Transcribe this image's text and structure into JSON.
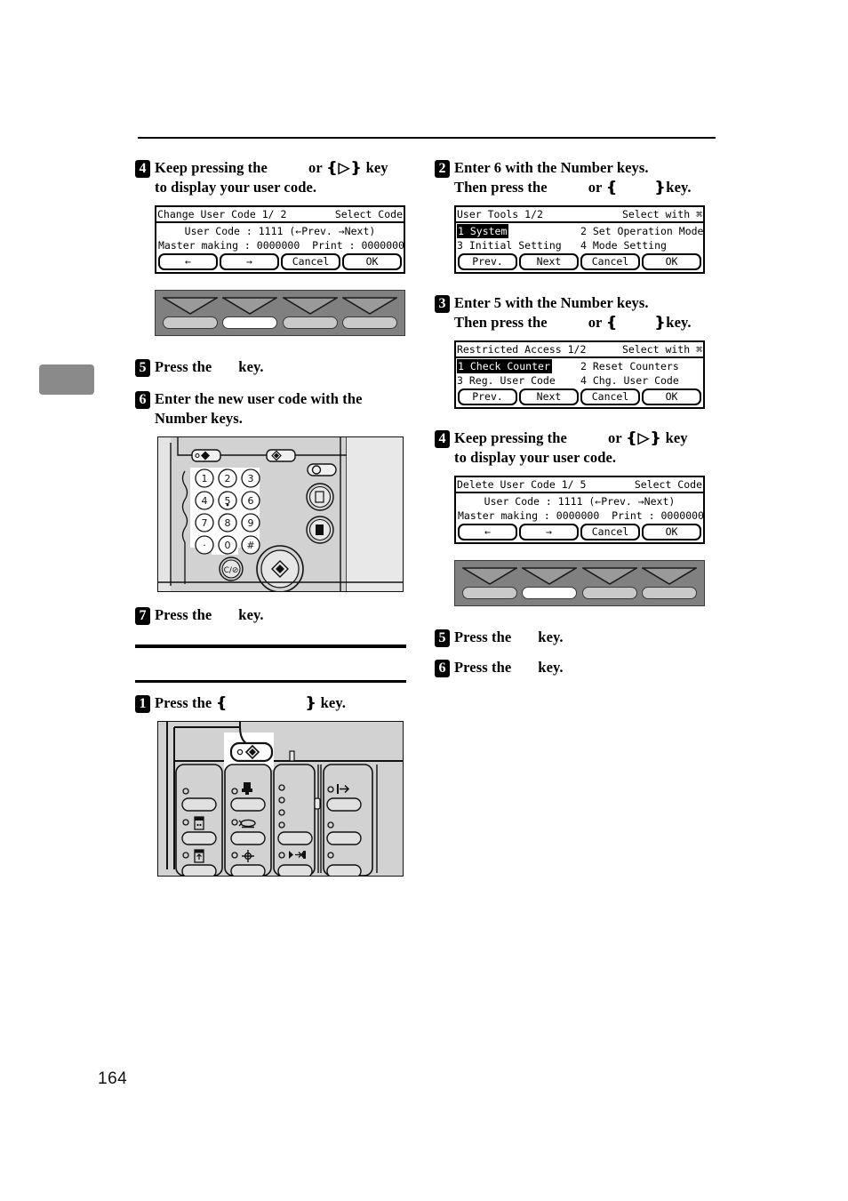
{
  "page": {
    "number": "164"
  },
  "left_column": {
    "steps": [
      {
        "num": "4",
        "line1_a": "Keep pressing the",
        "line1_b": "or",
        "line1_key": "▷",
        "line1_c": "key",
        "line2": "to display your user code."
      },
      {
        "num": "5",
        "line1_a": "Press the",
        "line1_c": "key."
      },
      {
        "num": "6",
        "line1_a": "Enter the new user code with the",
        "line2": "Number keys."
      },
      {
        "num": "7",
        "line1_a": "Press the",
        "line1_c": "key."
      },
      {
        "num": "1",
        "line1_a": "Press the",
        "line1_c": "key."
      }
    ],
    "lcd": {
      "title_left": "Change User Code  1/ 2",
      "title_right": "Select Code",
      "line1": "User Code : 1111 (←Prev. →Next)",
      "line2_left": "Master making : 0000000",
      "line2_right": "Print : 0000000",
      "buttons": [
        "←",
        "→",
        "Cancel",
        "OK"
      ]
    },
    "keystrip": {
      "keys": [
        "key-1",
        "key-2-selected",
        "key-3",
        "key-4"
      ],
      "highlighted_index": 1
    },
    "keypad_illustration": {
      "name": "number-keys-illustration",
      "keys": [
        "1",
        "2",
        "3",
        "4",
        "5",
        "6",
        "7",
        "8",
        "9",
        "·",
        "0",
        "#"
      ],
      "clear_stop_label": "C/⊘"
    },
    "panel_illustration": {
      "name": "operation-panel-illustration"
    }
  },
  "right_column": {
    "steps": [
      {
        "num": "2",
        "line1": "Enter 6 with the Number keys.",
        "line2_a": "Then press the",
        "line2_b": "or",
        "line2_c": "key."
      },
      {
        "num": "3",
        "line1": "Enter 5 with the Number keys.",
        "line2_a": "Then press the",
        "line2_b": "or",
        "line2_c": "key."
      },
      {
        "num": "4",
        "line1_a": "Keep pressing the",
        "line1_b": "or",
        "line1_key": "▷",
        "line1_c": "key",
        "line2": "to display your user code."
      },
      {
        "num": "5",
        "line1_a": "Press the",
        "line1_c": "key."
      },
      {
        "num": "6",
        "line1_a": "Press the",
        "line1_c": "key."
      }
    ],
    "lcd_user_tools": {
      "title_left": "User Tools 1/2",
      "title_right": "Select with ⌘",
      "items": [
        {
          "label": "1 System",
          "selected": true
        },
        {
          "label": "2 Set Operation Mode",
          "selected": false
        },
        {
          "label": "3 Initial Setting",
          "selected": false
        },
        {
          "label": "4 Mode Setting",
          "selected": false
        }
      ],
      "buttons": [
        "Prev.",
        "Next",
        "Cancel",
        "OK"
      ]
    },
    "lcd_restricted_access": {
      "title_left": "Restricted Access 1/2",
      "title_right": "Select with ⌘",
      "items": [
        {
          "label": "1 Check Counter",
          "selected": true
        },
        {
          "label": "2 Reset Counters",
          "selected": false
        },
        {
          "label": "3 Reg. User Code",
          "selected": false
        },
        {
          "label": "4 Chg. User Code",
          "selected": false
        }
      ],
      "buttons": [
        "Prev.",
        "Next",
        "Cancel",
        "OK"
      ]
    },
    "lcd_delete_user_code": {
      "title_left": "Delete User Code  1/ 5",
      "title_right": "Select Code",
      "line1": "User Code : 1111 (←Prev. →Next)",
      "line2_left": "Master making : 0000000",
      "line2_right": "Print : 0000000",
      "buttons": [
        "←",
        "→",
        "Cancel",
        "OK"
      ]
    },
    "keystrip": {
      "keys": [
        "key-1",
        "key-2-selected",
        "key-3",
        "key-4"
      ],
      "highlighted_index": 1
    }
  }
}
